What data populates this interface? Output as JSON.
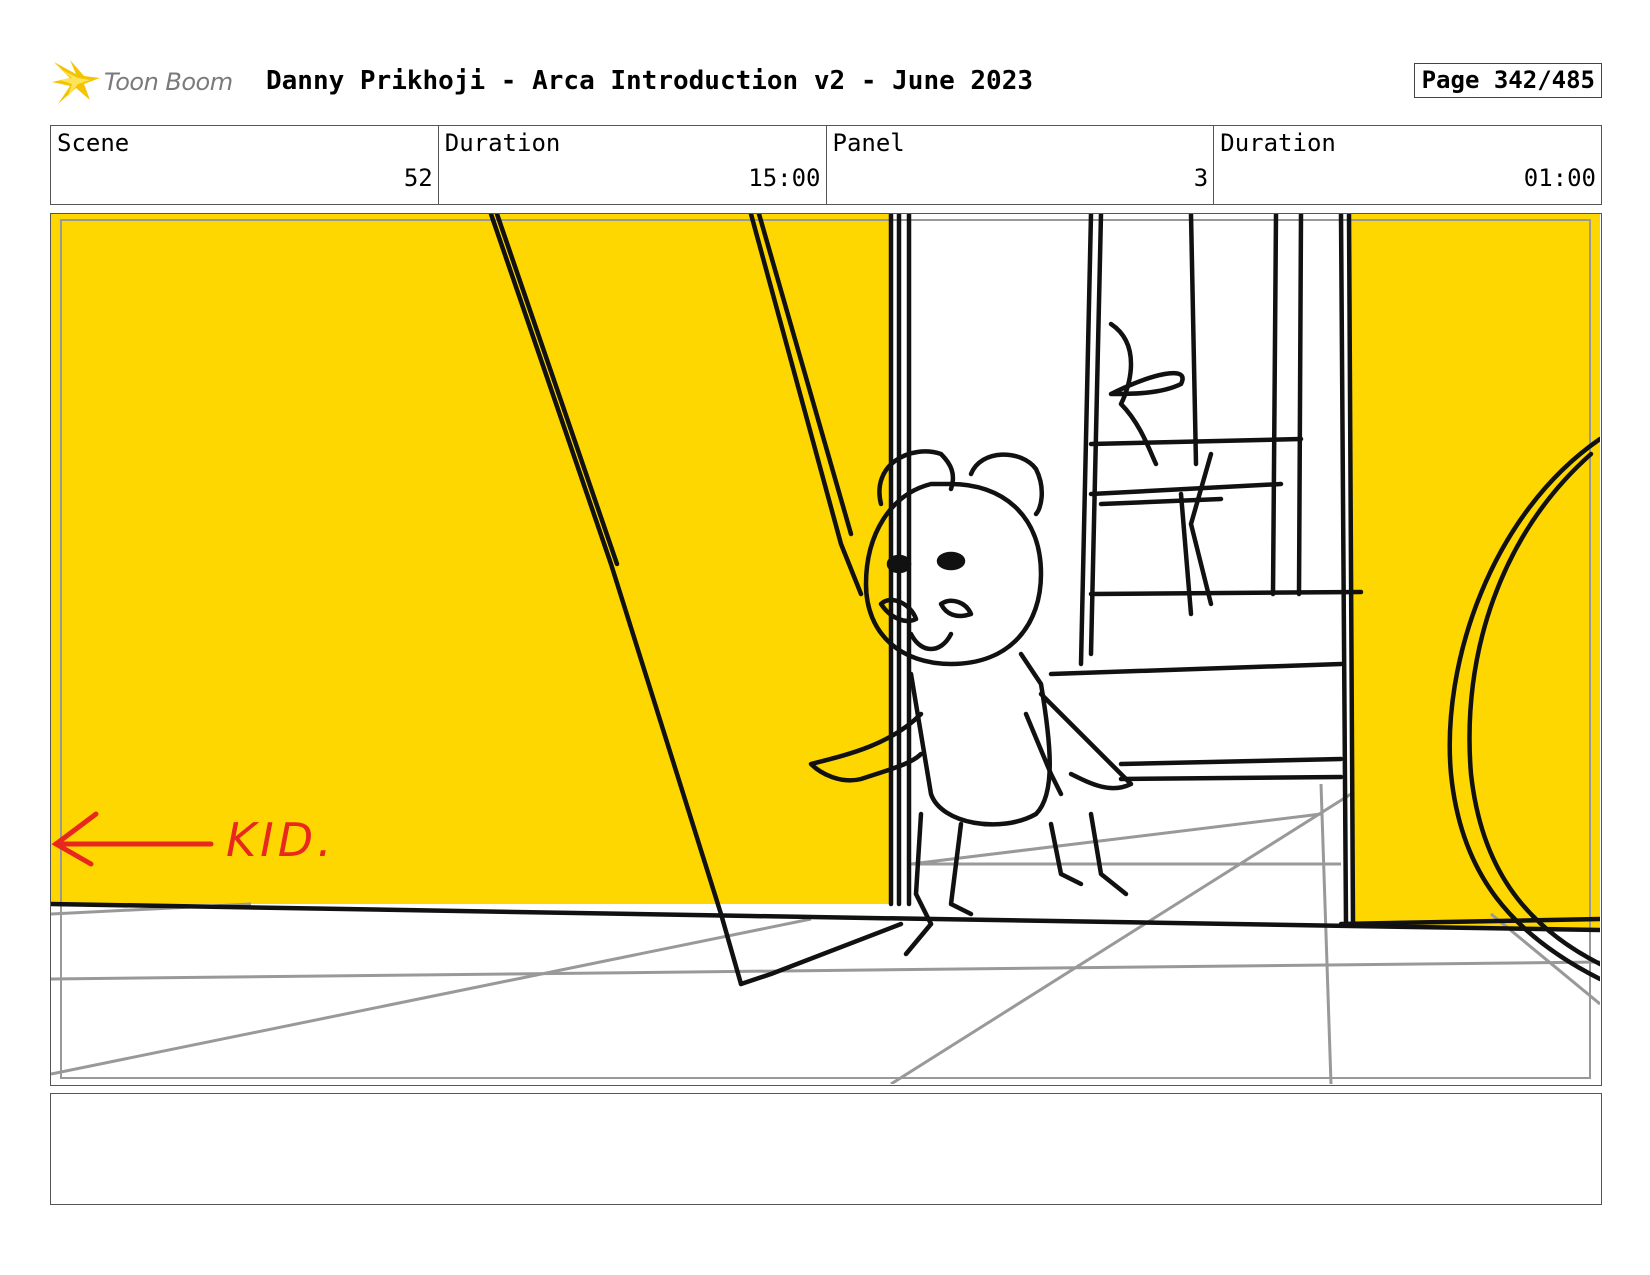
{
  "header": {
    "logo_text": "Toon Boom",
    "title": "Danny Prikhoji - Arca Introduction v2 - June 2023",
    "page": "Page 342/485"
  },
  "info": {
    "scene_label": "Scene",
    "scene_value": "52",
    "scene_duration_label": "Duration",
    "scene_duration_value": "15:00",
    "panel_label": "Panel",
    "panel_value": "3",
    "panel_duration_label": "Duration",
    "panel_duration_value": "01:00"
  },
  "panel": {
    "annotation": "KID.",
    "colors": {
      "wall": "#FFD700",
      "annotation": "#E8281E",
      "grid": "#999999",
      "ink": "#111111"
    }
  },
  "notes": {
    "text": ""
  }
}
